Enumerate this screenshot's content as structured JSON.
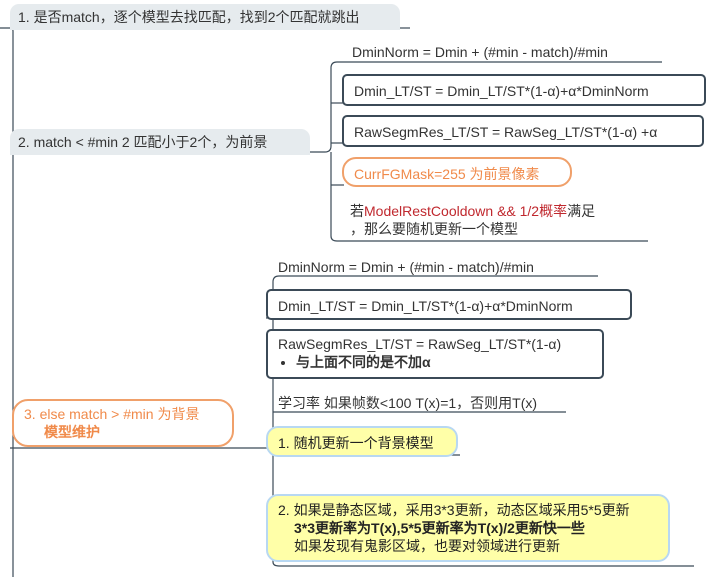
{
  "n1": {
    "label": "1. 是否match，逐个模型去找匹配，找到2个匹配就跳出"
  },
  "n2": {
    "label": "2. match < #min 2 匹配小于2个，为前景",
    "children": {
      "a": "DminNorm = Dmin + (#min - match)/#min",
      "b": "Dmin_LT/ST = Dmin_LT/ST*(1-α)+α*DminNorm",
      "c": "RawSegmRes_LT/ST = RawSeg_LT/ST*(1-α)  +α",
      "d": "CurrFGMask=255 为前景像素",
      "e_prefix": "若",
      "e_red": "ModelRestCooldown && 1/2概率",
      "e_suffix": "满足",
      "e_line2": "，那么要随机更新一个模型"
    }
  },
  "n3": {
    "label_line1": "3. else match > #min 为背景",
    "label_line2": "模型维护",
    "children": {
      "a": "DminNorm = Dmin + (#min - match)/#min",
      "b": "Dmin_LT/ST = Dmin_LT/ST*(1-α)+α*DminNorm",
      "c": "RawSegmRes_LT/ST = RawSeg_LT/ST*(1-α)",
      "c_bullet": "与上面不同的是不加α",
      "d": "学习率 如果帧数<100 T(x)=1，否则用T(x)",
      "e": "1. 随机更新一个背景模型",
      "f_line1": "2. 如果是静态区域，采用3*3更新，动态区域采用5*5更新",
      "f_line2": "3*3更新率为T(x),5*5更新率为T(x)/2更新快一些",
      "f_line3": "如果发现有鬼影区域，也要对领域进行更新"
    }
  },
  "colors": {
    "connector": "#3b4a57",
    "orange": "#f0a06a",
    "yellow_fill": "#ffffa8",
    "red_text": "#c0282e",
    "shade": "#e6ebee"
  }
}
